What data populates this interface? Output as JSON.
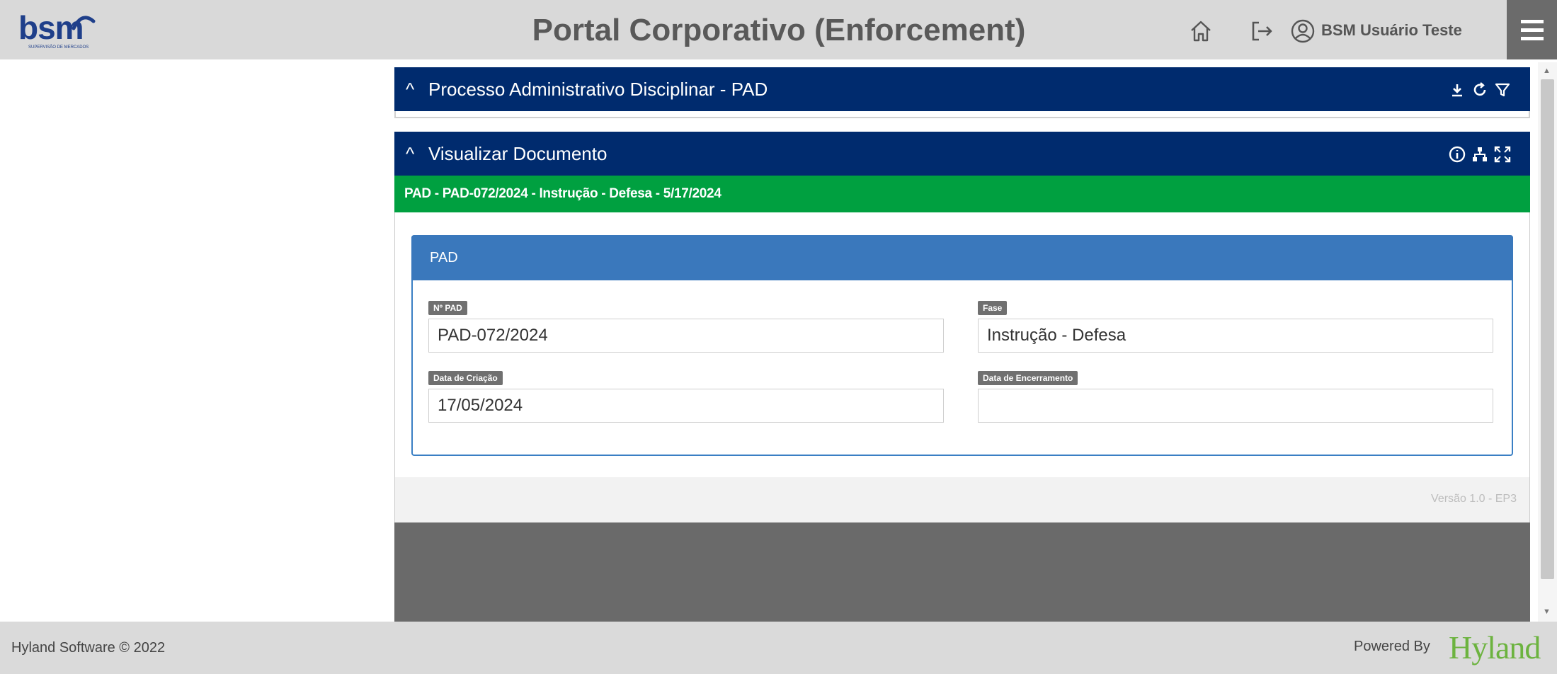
{
  "header": {
    "logo_text": "bsm",
    "logo_subtext": "SUPERVISÃO DE MERCADOS",
    "title": "Portal Corporativo (Enforcement)",
    "user_name": "BSM Usuário Teste",
    "icons": [
      "home-icon",
      "logout-icon",
      "user-circle-icon",
      "hamburger-menu-icon"
    ]
  },
  "panels": {
    "pad_panel": {
      "title": "Processo Administrativo Disciplinar - PAD",
      "icons": [
        "download-icon",
        "refresh-icon",
        "filter-icon"
      ]
    },
    "document_panel": {
      "title": "Visualizar Documento",
      "icons": [
        "info-icon",
        "sitemap-icon",
        "expand-icon"
      ],
      "breadcrumb": "PAD - PAD-072/2024 - Instrução - Defesa - 5/17/2024"
    }
  },
  "form": {
    "card_title": "PAD",
    "fields": {
      "numero_pad": {
        "label": "Nº PAD",
        "value": "PAD-072/2024"
      },
      "fase": {
        "label": "Fase",
        "value": "Instrução - Defesa"
      },
      "data_criacao": {
        "label": "Data de Criação",
        "value": "17/05/2024"
      },
      "data_encerramento": {
        "label": "Data de Encerramento",
        "value": ""
      }
    }
  },
  "version": "Versão 1.0 - EP3",
  "footer": {
    "copyright": "Hyland Software © 2022",
    "powered_by": "Powered By",
    "brand": "Hyland"
  },
  "colors": {
    "header_bg": "#d9d9d9",
    "panel_navy": "#002b6e",
    "breadcrumb_green": "#00a040",
    "card_blue": "#3a78bc",
    "hyland_green": "#6cb33f"
  }
}
